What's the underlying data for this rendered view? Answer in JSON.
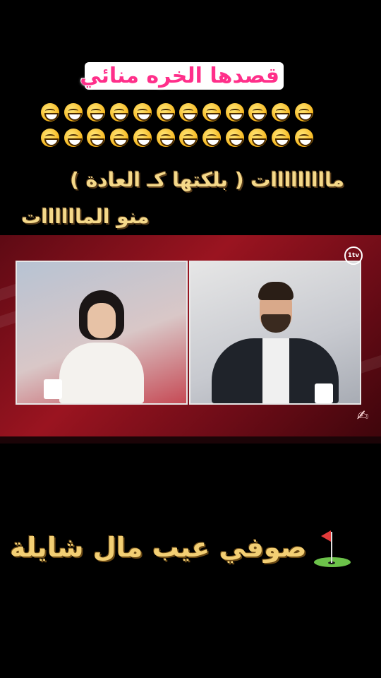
{
  "captions": {
    "title": "قصدها الخره منائي",
    "line2": "مااااااااات ( بلكتها كـ العادة )",
    "line3": "منو الماااااات",
    "bottom": "صوفي عيب مال شايلة"
  },
  "emoji": {
    "name": "grinning-face-icon",
    "row1_count": 12,
    "row2_count": 12
  },
  "video": {
    "channel_logo": "1tv",
    "colors": {
      "background": "#9a1420",
      "frame_border": "#e8e8e8"
    }
  },
  "icons": {
    "bottom_icon": "golf-flag-icon"
  }
}
